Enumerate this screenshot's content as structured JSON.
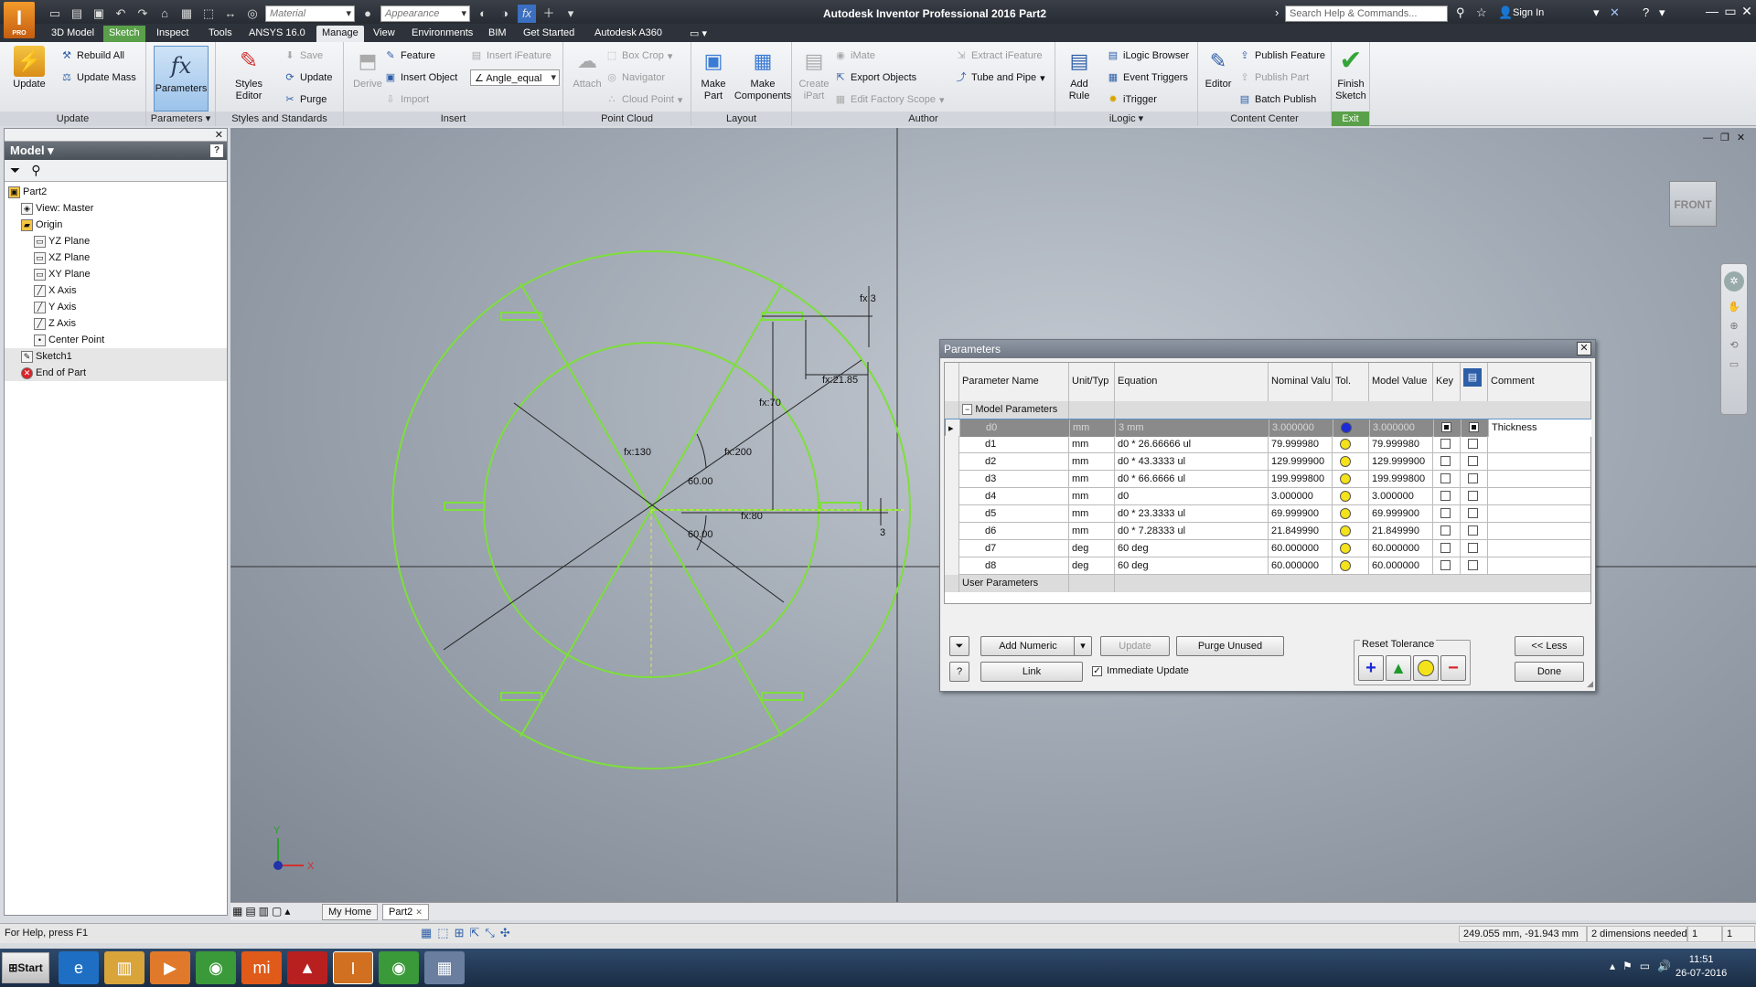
{
  "app": {
    "logo_text": "I",
    "logo_sub": "PRO",
    "window_title": "Autodesk Inventor Professional 2016   Part2",
    "material_placeholder": "Material",
    "appearance_placeholder": "Appearance",
    "search_placeholder": "Search Help & Commands...",
    "sign_in": "Sign In"
  },
  "tabs": [
    "3D Model",
    "Sketch",
    "Inspect",
    "Tools",
    "ANSYS 16.0",
    "Manage",
    "View",
    "Environments",
    "BIM",
    "Get Started",
    "Autodesk A360"
  ],
  "active_tab": "Manage",
  "ribbon": {
    "update_panel": {
      "title": "Update",
      "update": "Update",
      "rebuild_all": "Rebuild All",
      "update_mass": "Update Mass"
    },
    "parameters_panel": {
      "title": "Parameters",
      "parameters": "Parameters"
    },
    "styles_panel": {
      "title": "Styles and Standards",
      "styles_editor": "Styles Editor",
      "save": "Save",
      "update": "Update",
      "purge": "Purge"
    },
    "insert_panel": {
      "title": "Insert",
      "derive": "Derive",
      "feature": "Feature",
      "insert_object": "Insert Object",
      "import": "Import",
      "insert_ifeature": "Insert iFeature",
      "angle_combo": "Angle_equal"
    },
    "point_cloud_panel": {
      "title": "Point Cloud",
      "attach": "Attach",
      "box_crop": "Box Crop",
      "navigator": "Navigator",
      "cloud_point": "Cloud Point"
    },
    "layout_panel": {
      "title": "Layout",
      "make_part": "Make Part",
      "make_components": "Make Components"
    },
    "author_panel": {
      "title": "Author",
      "create_ipart": "Create iPart",
      "imate": "iMate",
      "export_objects": "Export Objects",
      "edit_factory_scope": "Edit Factory Scope",
      "extract_ifeature": "Extract iFeature",
      "tube_and_pipe": "Tube and Pipe"
    },
    "ilogic_panel": {
      "title": "iLogic",
      "add_rule": "Add Rule",
      "ilogic_browser": "iLogic Browser",
      "event_triggers": "Event Triggers",
      "itrigger": "iTrigger"
    },
    "content_center_panel": {
      "title": "Content Center",
      "editor": "Editor",
      "publish_feature": "Publish Feature",
      "publish_part": "Publish Part",
      "batch_publish": "Batch Publish"
    },
    "exit_panel": {
      "title": "Exit",
      "finish_sketch": "Finish Sketch"
    }
  },
  "browser": {
    "title": "Model",
    "tree": [
      {
        "label": "Part2",
        "indent": 0,
        "icon": "part-icon"
      },
      {
        "label": "View: Master",
        "indent": 1,
        "icon": "view-icon"
      },
      {
        "label": "Origin",
        "indent": 1,
        "icon": "folder-icon"
      },
      {
        "label": "YZ Plane",
        "indent": 2,
        "icon": "plane-icon"
      },
      {
        "label": "XZ Plane",
        "indent": 2,
        "icon": "plane-icon"
      },
      {
        "label": "XY Plane",
        "indent": 2,
        "icon": "plane-icon"
      },
      {
        "label": "X Axis",
        "indent": 2,
        "icon": "axis-icon"
      },
      {
        "label": "Y Axis",
        "indent": 2,
        "icon": "axis-icon"
      },
      {
        "label": "Z Axis",
        "indent": 2,
        "icon": "axis-icon"
      },
      {
        "label": "Center Point",
        "indent": 2,
        "icon": "point-icon"
      },
      {
        "label": "Sketch1",
        "indent": 1,
        "icon": "sketch-icon"
      },
      {
        "label": "End of Part",
        "indent": 1,
        "icon": "end-of-part-icon"
      }
    ]
  },
  "viewcube_label": "FRONT",
  "sketch_dims": {
    "d130": "fx:130",
    "d200": "fx:200",
    "d70": "fx:70",
    "d80": "fx:80",
    "d3_top": "fx:3",
    "d21": "fx:21.85",
    "a60_top": "60.00",
    "a60_bot": "60.00",
    "d3_right": "3"
  },
  "axis_labels": {
    "x": "X",
    "y": "Y"
  },
  "document_tabs": [
    "My Home",
    "Part2"
  ],
  "parameters_dialog": {
    "title": "Parameters",
    "columns": [
      "Parameter Name",
      "Unit/Typ",
      "Equation",
      "Nominal Valu",
      "Tol.",
      "Model Value",
      "Key",
      "Comment"
    ],
    "model_group": "Model Parameters",
    "user_group": "User Parameters",
    "rows": [
      {
        "name": "d0",
        "unit": "mm",
        "equation": "3 mm",
        "nominal": "3.000000",
        "tol": "blue",
        "model": "3.000000",
        "key": true,
        "export": true,
        "comment": "Thickness"
      },
      {
        "name": "d1",
        "unit": "mm",
        "equation": "d0 * 26.66666 ul",
        "nominal": "79.999980",
        "tol": "yellow",
        "model": "79.999980",
        "key": false,
        "export": false,
        "comment": ""
      },
      {
        "name": "d2",
        "unit": "mm",
        "equation": "d0 * 43.3333 ul",
        "nominal": "129.999900",
        "tol": "yellow",
        "model": "129.999900",
        "key": false,
        "export": false,
        "comment": ""
      },
      {
        "name": "d3",
        "unit": "mm",
        "equation": "d0 * 66.6666 ul",
        "nominal": "199.999800",
        "tol": "yellow",
        "model": "199.999800",
        "key": false,
        "export": false,
        "comment": ""
      },
      {
        "name": "d4",
        "unit": "mm",
        "equation": "d0",
        "nominal": "3.000000",
        "tol": "yellow",
        "model": "3.000000",
        "key": false,
        "export": false,
        "comment": ""
      },
      {
        "name": "d5",
        "unit": "mm",
        "equation": "d0 * 23.3333 ul",
        "nominal": "69.999900",
        "tol": "yellow",
        "model": "69.999900",
        "key": false,
        "export": false,
        "comment": ""
      },
      {
        "name": "d6",
        "unit": "mm",
        "equation": "d0 * 7.28333 ul",
        "nominal": "21.849990",
        "tol": "yellow",
        "model": "21.849990",
        "key": false,
        "export": false,
        "comment": ""
      },
      {
        "name": "d7",
        "unit": "deg",
        "equation": "60 deg",
        "nominal": "60.000000",
        "tol": "yellow",
        "model": "60.000000",
        "key": false,
        "export": false,
        "comment": ""
      },
      {
        "name": "d8",
        "unit": "deg",
        "equation": "60 deg",
        "nominal": "60.000000",
        "tol": "yellow",
        "model": "60.000000",
        "key": false,
        "export": false,
        "comment": ""
      }
    ],
    "add_numeric": "Add Numeric",
    "update": "Update",
    "purge_unused": "Purge Unused",
    "link": "Link",
    "immediate_update": "Immediate Update",
    "reset_tolerance": "Reset Tolerance",
    "less": "<< Less",
    "done": "Done"
  },
  "status": {
    "help": "For Help, press F1",
    "coords": "249.055 mm, -91.943 mm",
    "dims_needed": "2 dimensions needed",
    "val1": "1",
    "val2": "1"
  },
  "taskbar": {
    "start": "Start",
    "time": "11:51",
    "date": "26-07-2016"
  },
  "colors": {
    "sketch": "#7ddf3a",
    "accent": "#5e94cc",
    "tol_blue": "#1c2bd8",
    "tol_yellow": "#f4e21a"
  }
}
